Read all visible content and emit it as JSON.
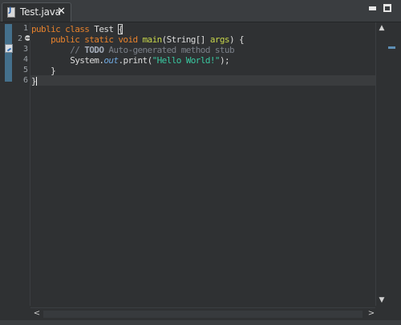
{
  "tab": {
    "title": "Test.java",
    "icon": "java-file-icon",
    "close_glyph": "✕"
  },
  "window_controls": {
    "minimize": "minimize-icon",
    "maximize": "maximize-icon"
  },
  "editor": {
    "line_numbers": [
      "1",
      "2",
      "3",
      "4",
      "5",
      "6"
    ],
    "code": {
      "l1_kw": "public class",
      "l1_name": " Test ",
      "l1_brace": "{",
      "l2_indent": "    ",
      "l2_kw": "public static void",
      "l2_sp": " ",
      "l2_method": "main",
      "l2_paren_open": "(String[] ",
      "l2_param": "args",
      "l2_rest": ") {",
      "l3_indent": "        ",
      "l3_comment_start": "// ",
      "l3_todo": "TODO",
      "l3_comment_rest": " Auto-generated method stub",
      "l4_indent": "        ",
      "l4_class": "System.",
      "l4_field": "out",
      "l4_call": ".print(",
      "l4_string": "\"Hello World!\"",
      "l4_end": ");",
      "l5_indent": "    ",
      "l5_brace": "}",
      "l6_brace": "}"
    }
  },
  "scrollbars": {
    "up": "▲",
    "down": "▼",
    "left": "<",
    "right": ">"
  },
  "colors": {
    "keyword": "#e6812c",
    "method": "#c6d54a",
    "comment": "#7b8089",
    "string": "#39c8a0",
    "static_field": "#6fa8e0",
    "background": "#2f3133"
  }
}
